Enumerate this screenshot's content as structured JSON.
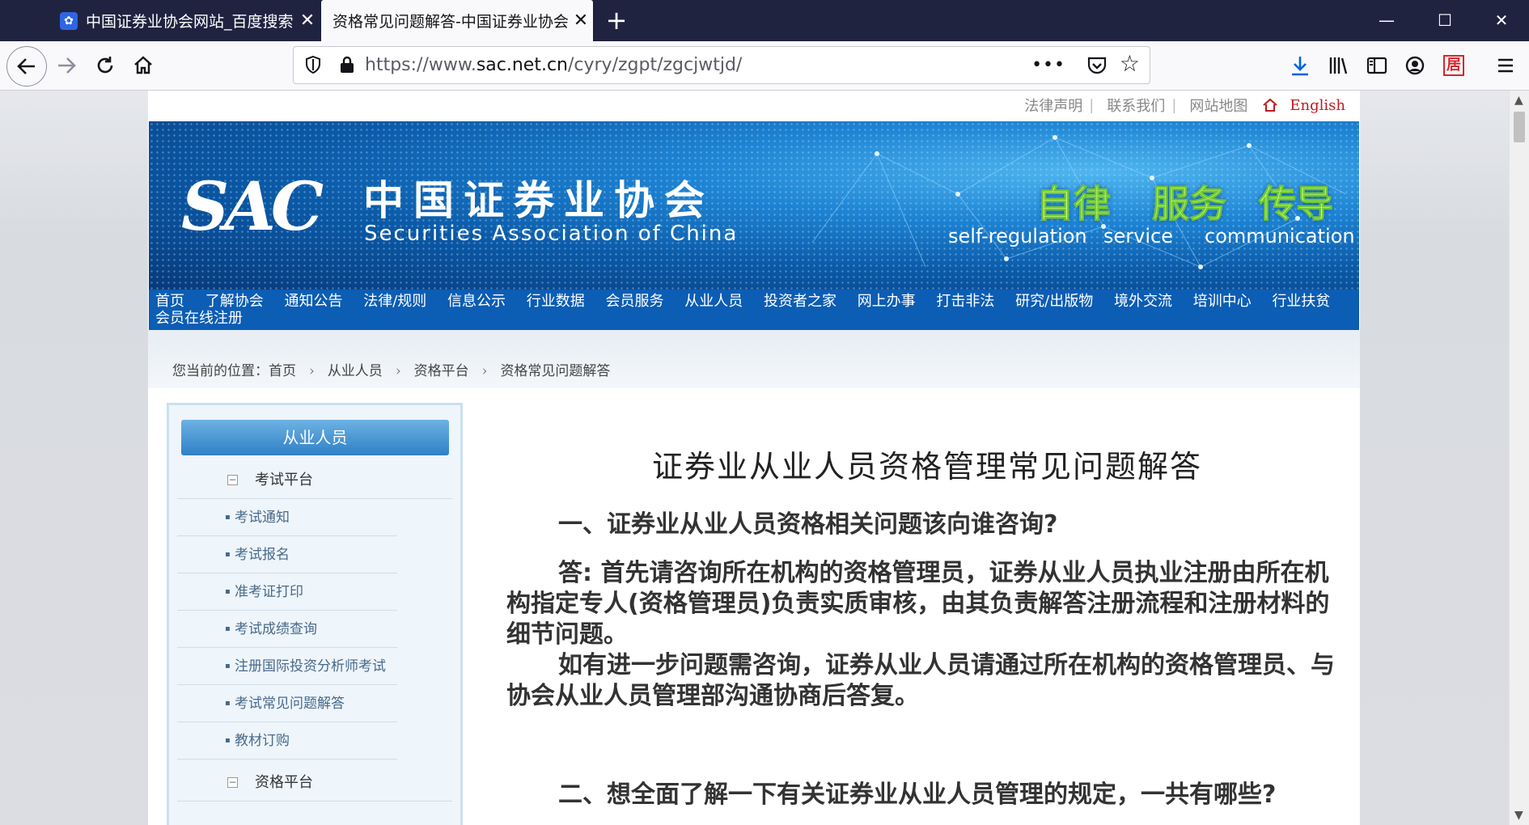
{
  "browser": {
    "tabs": [
      {
        "title": "中国证券业协会网站_百度搜索",
        "favicon": "baidu-paw-icon",
        "active": false
      },
      {
        "title": "资格常见问题解答-中国证券业协会",
        "active": true
      }
    ],
    "url": "https://www.sac.net.cn/cyry/zgpt/zgcjwtjd/",
    "url_prefix": "https://www.",
    "url_domain": "sac.net.cn",
    "url_path": "/cyry/zgpt/zgcjwtjd/"
  },
  "site": {
    "top_links": [
      "法律声明",
      "联系我们",
      "网站地图"
    ],
    "english": "English",
    "logo_abbr": "SAC",
    "logo_cn": "中国证券业协会",
    "logo_en": "Securities Association of China",
    "slogans": [
      {
        "cn": "自律",
        "en": "self-regulation"
      },
      {
        "cn": "服务",
        "en": "service"
      },
      {
        "cn": "传导",
        "en": "communication"
      }
    ],
    "nav": [
      "首页",
      "了解协会",
      "通知公告",
      "法律/规则",
      "信息公示",
      "行业数据",
      "会员服务",
      "从业人员",
      "投资者之家",
      "网上办事",
      "打击非法",
      "研究/出版物",
      "境外交流",
      "培训中心",
      "行业扶贫",
      "会员在线注册"
    ]
  },
  "breadcrumb": {
    "prefix": "您当前的位置：",
    "items": [
      "首页",
      "从业人员",
      "资格平台",
      "资格常见问题解答"
    ]
  },
  "sidebar": {
    "title": "从业人员",
    "group1": "考试平台",
    "items": [
      "考试通知",
      "考试报名",
      "准考证打印",
      "考试成绩查询",
      "注册国际投资分析师考试",
      "考试常见问题解答",
      "教材订购"
    ],
    "group2": "资格平台"
  },
  "article": {
    "title": "证券业从业人员资格管理常见问题解答",
    "q1": "一、证券业从业人员资格相关问题该向谁咨询?",
    "a1": "答: 首先请咨询所在机构的资格管理员，证券从业人员执业注册由所在机构指定专人(资格管理员)负责实质审核，由其负责解答注册流程和注册材料的细节问题。",
    "a1b": "如有进一步问题需咨询，证券从业人员请通过所在机构的资格管理员、与协会从业人员管理部沟通协商后答复。",
    "q2": "二、想全面了解一下有关证券业从业人员管理的规定，一共有哪些?"
  }
}
